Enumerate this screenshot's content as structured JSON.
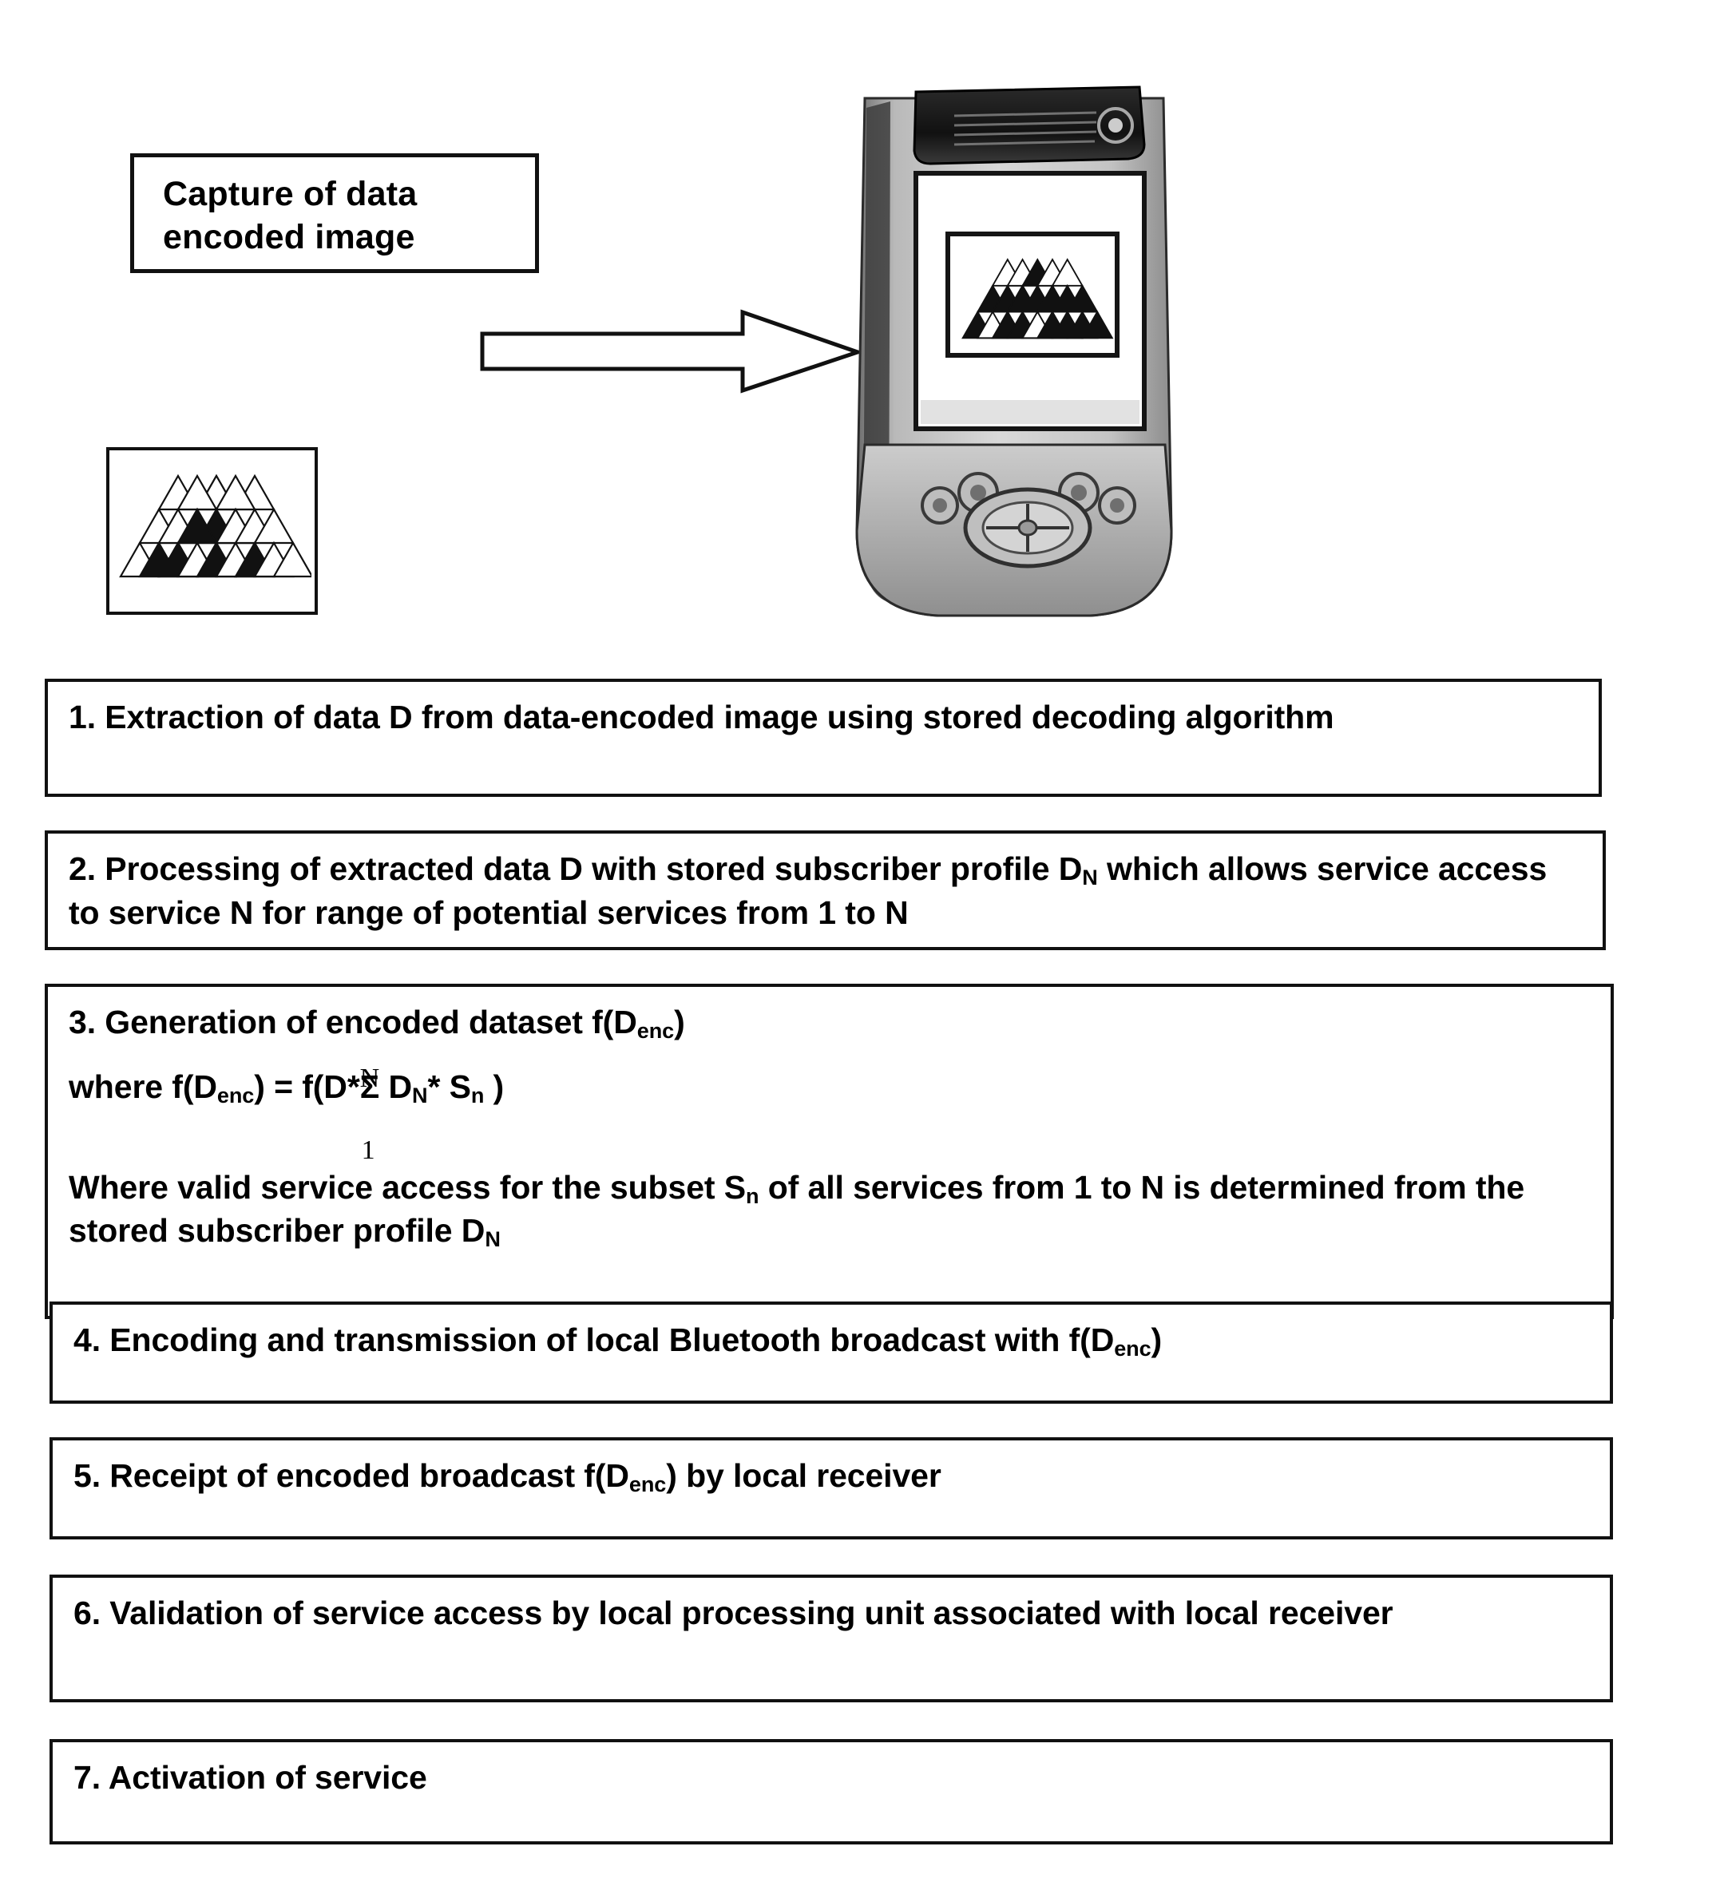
{
  "caption": {
    "text": "Capture of data\nencoded image"
  },
  "icons": {
    "arrow": "right-arrow-icon",
    "encoded_image": "triangular-data-encoded-image",
    "device": "pda-device-photo",
    "device_screen_image": "triangular-data-encoded-image"
  },
  "steps": [
    {
      "id": "step-1",
      "number": "1.",
      "text": "1. Extraction of data D from data-encoded image using stored decoding algorithm"
    },
    {
      "id": "step-2",
      "number": "2.",
      "text_prefix": "2. Processing of extracted data D with stored subscriber profile D",
      "sub_1": "N",
      "text_mid": " which allows service access to service N for range of potential services from 1 to N"
    },
    {
      "id": "step-3",
      "number": "3.",
      "heading_prefix": "3. Generation of encoded dataset f(D",
      "heading_sub": "enc",
      "heading_suffix": ")",
      "formula_prefix": "where f(D",
      "formula_sub_1": "enc",
      "formula_mid": ") = f(D*",
      "formula_sigma": "Σ",
      "formula_sigma_top": "N",
      "formula_sigma_bottom": "1",
      "formula_after": " D",
      "formula_sub_2": "N",
      "formula_star": "* S",
      "formula_sub_3": "n",
      "formula_close": " )",
      "body_prefix": "Where valid service access for the subset S",
      "body_sub_1": "n",
      "body_mid": " of all services from 1 to N is determined from the stored subscriber profile D",
      "body_sub_2": "N"
    },
    {
      "id": "step-4",
      "number": "4.",
      "text_prefix": "4. Encoding and transmission of local Bluetooth broadcast with f(D",
      "sub_1": "enc",
      "text_suffix": ")"
    },
    {
      "id": "step-5",
      "number": "5.",
      "text_prefix": "5. Receipt of encoded broadcast f(D",
      "sub_1": "enc",
      "text_suffix": ") by local receiver"
    },
    {
      "id": "step-6",
      "number": "6.",
      "text": "6. Validation of service access by local processing unit associated with local receiver"
    },
    {
      "id": "step-7",
      "number": "7.",
      "text": "7. Activation of service"
    }
  ],
  "colors": {
    "ink": "#111111",
    "paper": "#ffffff"
  }
}
